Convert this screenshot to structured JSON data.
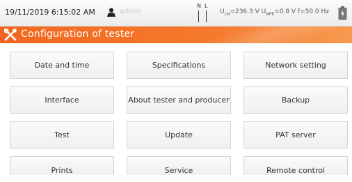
{
  "status": {
    "datetime": "19/11/2019 6:15:02 AM",
    "user": "admin",
    "nl_labels": [
      "N",
      "L"
    ],
    "voltage_uln": "236.3 V",
    "voltage_upe": "0.8 V",
    "frequency": "f=50.0 Hz",
    "icons": [
      "user-icon",
      "battery-icon"
    ]
  },
  "header": {
    "title": "Configuration of tester",
    "icon": "tools-icon",
    "accent_color": "#f2661f"
  },
  "menu": [
    [
      "Date and time",
      "Specifications",
      "Network setting"
    ],
    [
      "Interface",
      "About tester and producer",
      "Backup"
    ],
    [
      "Test",
      "Update",
      "PAT server"
    ],
    [
      "Prints",
      "Service",
      "Remote control"
    ]
  ]
}
